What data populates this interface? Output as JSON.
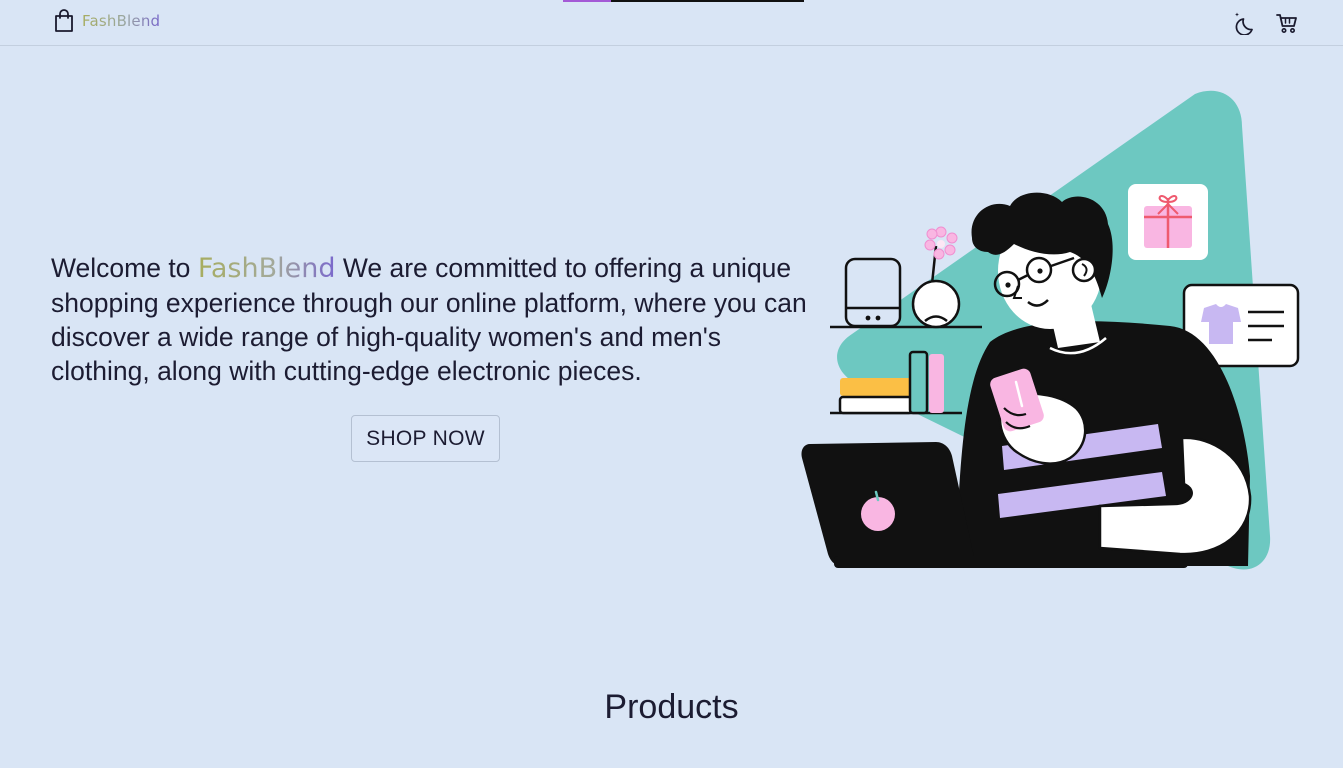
{
  "brand": {
    "name": "FashBlend",
    "icon": "shopping-bag-icon",
    "gradient": [
      "#a7ad5f",
      "#7766c9"
    ]
  },
  "nav": {
    "icons": [
      "dark-mode-moon-icon",
      "cart-icon"
    ]
  },
  "hero": {
    "welcome": "Welcome to",
    "brand_name": "FashBlend",
    "body": "We are committed to offering a unique shopping experience through our online platform, where you can discover a wide range of high-quality women's and men's clothing, along with cutting-edge electronic pieces.",
    "cta_label": "SHOP NOW",
    "illustration": "person-shopping-on-phone-illustration"
  },
  "sections": {
    "products_title": "Products"
  },
  "colors": {
    "background": "#d9e5f5",
    "text": "#1c1c32",
    "illustration_teal": "#6dc8c1",
    "illustration_lavender": "#c8b8f2",
    "illustration_pink": "#f9b6e2",
    "loading_accent": "#a45ad6"
  }
}
